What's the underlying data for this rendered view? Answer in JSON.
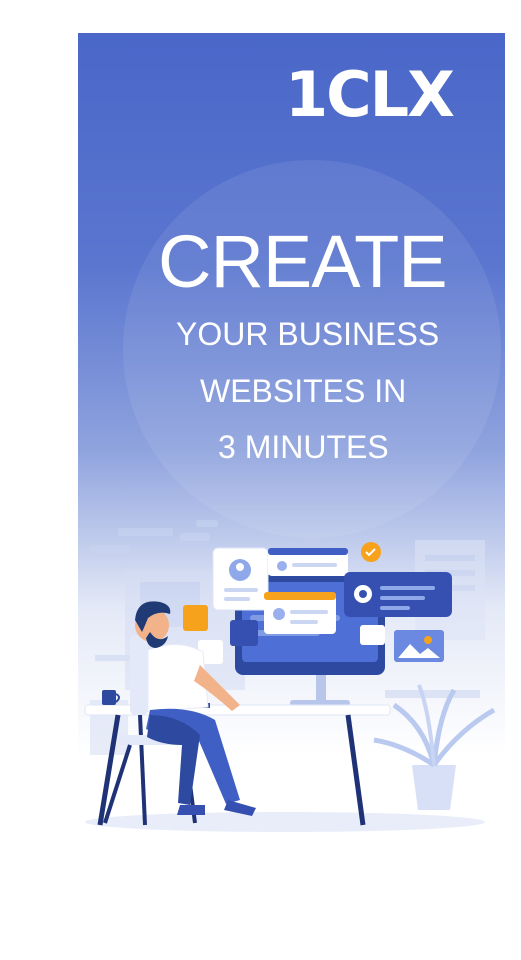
{
  "brand": {
    "logo_text": "1CLX"
  },
  "hero": {
    "headline": "CREATE",
    "subline_1": "YOUR BUSINESS",
    "subline_2": "WEBSITES IN",
    "subline_3": "3 MINUTES"
  },
  "colors": {
    "primary_blue": "#4a67c9",
    "accent_orange": "#f6a21c",
    "skin": "#f2b28a",
    "hair": "#1f3a75"
  },
  "illustration": {
    "scene": "man-working-at-desktop",
    "icons": [
      "user-card-icon",
      "gear-icon",
      "check-icon",
      "image-icon",
      "plant-icon"
    ]
  }
}
